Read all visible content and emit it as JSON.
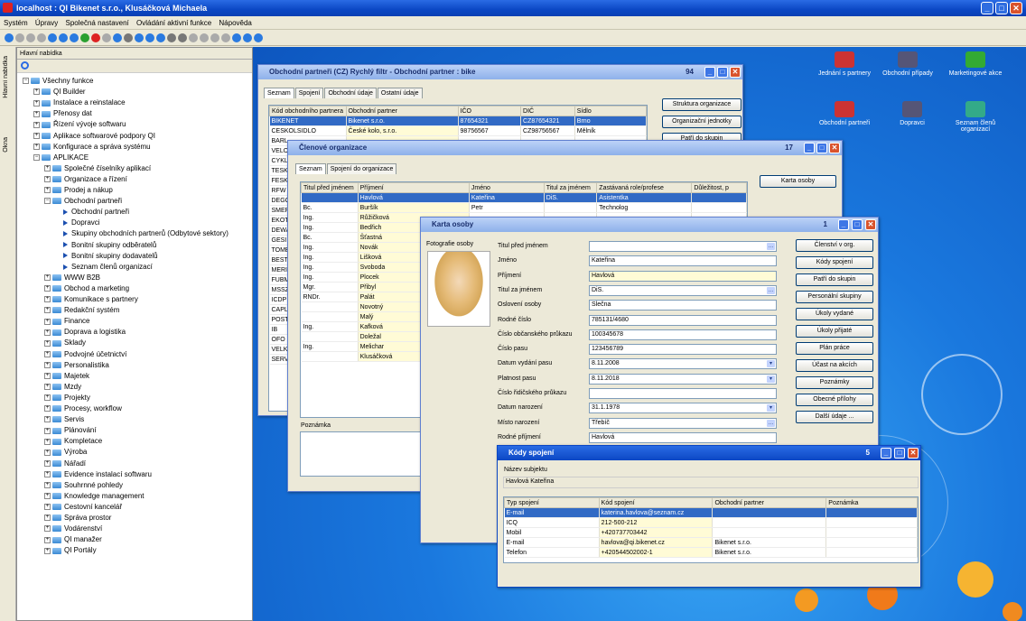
{
  "app": {
    "title": "localhost : QI  Bikenet s.r.o., Klusáčková Michaela",
    "min": "_",
    "max": "□",
    "close": "✕"
  },
  "menu": [
    "Systém",
    "Úpravy",
    "Společná nastavení",
    "Ovládání aktivní funkce",
    "Nápověda"
  ],
  "left_tabs": [
    "Hlavní nabídka",
    "Okna"
  ],
  "nav": {
    "header": "Hlavní nabídka",
    "items": [
      {
        "t": "Všechny funkce",
        "l": 0,
        "k": "f",
        "e": "−"
      },
      {
        "t": "QI Builder",
        "l": 1,
        "k": "f",
        "e": "+"
      },
      {
        "t": "Instalace a reinstalace",
        "l": 1,
        "k": "f",
        "e": "+"
      },
      {
        "t": "Přenosy dat",
        "l": 1,
        "k": "f",
        "e": "+"
      },
      {
        "t": "Řízení vývoje softwaru",
        "l": 1,
        "k": "f",
        "e": "+"
      },
      {
        "t": "Aplikace softwarové podpory QI",
        "l": 1,
        "k": "f",
        "e": "+"
      },
      {
        "t": "Konfigurace a správa systému",
        "l": 1,
        "k": "f",
        "e": "+"
      },
      {
        "t": "APLIKACE",
        "l": 1,
        "k": "f",
        "e": "−"
      },
      {
        "t": "Společné číselníky aplikací",
        "l": 2,
        "k": "f",
        "e": "+"
      },
      {
        "t": "Organizace a řízení",
        "l": 2,
        "k": "f",
        "e": "+"
      },
      {
        "t": "Prodej a nákup",
        "l": 2,
        "k": "f",
        "e": "+"
      },
      {
        "t": "Obchodní partneři",
        "l": 2,
        "k": "f",
        "e": "−"
      },
      {
        "t": "Obchodní partneři",
        "l": 3,
        "k": "a"
      },
      {
        "t": "Dopravci",
        "l": 3,
        "k": "a"
      },
      {
        "t": "Skupiny obchodních partnerů (Odbytové sektory)",
        "l": 3,
        "k": "a"
      },
      {
        "t": "Bonitní skupiny odběratelů",
        "l": 3,
        "k": "a"
      },
      {
        "t": "Bonitní skupiny dodavatelů",
        "l": 3,
        "k": "a"
      },
      {
        "t": "Seznam členů organizací",
        "l": 3,
        "k": "a"
      },
      {
        "t": "WWW B2B",
        "l": 2,
        "k": "f",
        "e": "+"
      },
      {
        "t": "Obchod a marketing",
        "l": 2,
        "k": "f",
        "e": "+"
      },
      {
        "t": "Komunikace s partnery",
        "l": 2,
        "k": "f",
        "e": "+"
      },
      {
        "t": "Redakční systém",
        "l": 2,
        "k": "f",
        "e": "+"
      },
      {
        "t": "Finance",
        "l": 2,
        "k": "f",
        "e": "+"
      },
      {
        "t": "Doprava a logistika",
        "l": 2,
        "k": "f",
        "e": "+"
      },
      {
        "t": "Sklady",
        "l": 2,
        "k": "f",
        "e": "+"
      },
      {
        "t": "Podvojné účetnictví",
        "l": 2,
        "k": "f",
        "e": "+"
      },
      {
        "t": "Personalistika",
        "l": 2,
        "k": "f",
        "e": "+"
      },
      {
        "t": "Majetek",
        "l": 2,
        "k": "f",
        "e": "+"
      },
      {
        "t": "Mzdy",
        "l": 2,
        "k": "f",
        "e": "+"
      },
      {
        "t": "Projekty",
        "l": 2,
        "k": "f",
        "e": "+"
      },
      {
        "t": "Procesy, workflow",
        "l": 2,
        "k": "f",
        "e": "+"
      },
      {
        "t": "Servis",
        "l": 2,
        "k": "f",
        "e": "+"
      },
      {
        "t": "Plánování",
        "l": 2,
        "k": "f",
        "e": "+"
      },
      {
        "t": "Kompletace",
        "l": 2,
        "k": "f",
        "e": "+"
      },
      {
        "t": "Výroba",
        "l": 2,
        "k": "f",
        "e": "+"
      },
      {
        "t": "Nářadí",
        "l": 2,
        "k": "f",
        "e": "+"
      },
      {
        "t": "Evidence instalací softwaru",
        "l": 2,
        "k": "f",
        "e": "+"
      },
      {
        "t": "Souhrnné pohledy",
        "l": 2,
        "k": "f",
        "e": "+"
      },
      {
        "t": "Knowledge management",
        "l": 2,
        "k": "f",
        "e": "+"
      },
      {
        "t": "Cestovní kancelář",
        "l": 2,
        "k": "f",
        "e": "+"
      },
      {
        "t": "Správa prostor",
        "l": 2,
        "k": "f",
        "e": "+"
      },
      {
        "t": "Vodárenství",
        "l": 2,
        "k": "f",
        "e": "+"
      },
      {
        "t": "QI manažer",
        "l": 2,
        "k": "f",
        "e": "+"
      },
      {
        "t": "QI Portály",
        "l": 2,
        "k": "f",
        "e": "+"
      }
    ]
  },
  "desktop_icons": [
    "Jednání s partnery",
    "Obchodní případy",
    "Marketingové akce",
    "Obchodní partneři",
    "Dopravci",
    "Seznam členů organizací"
  ],
  "w1": {
    "title": "Obchodní partneři (CZ)  Rychlý filtr - Obchodní partner : bike",
    "count": "94",
    "tabs": [
      "Seznam",
      "Spojení",
      "Obchodní údaje",
      "Ostatní údaje"
    ],
    "cols": [
      "Kód obchodního partnera",
      "Obchodní partner",
      "IČO",
      "DIČ",
      "Sídlo"
    ],
    "rows": [
      [
        "BIKENET",
        "Bikenet s.r.o.",
        "87654321",
        "CZ87654321",
        "Brno"
      ],
      [
        "CESKOLSIDLO",
        "České kolo, s.r.o.",
        "98756567",
        "CZ98756567",
        "Mělník"
      ],
      [
        "BARL",
        "",
        "",
        "",
        ""
      ],
      [
        "VELO",
        "",
        "",
        "",
        ""
      ],
      [
        "CYKL",
        "",
        "",
        "",
        ""
      ],
      [
        "TESK",
        "",
        "",
        "",
        ""
      ],
      [
        "FESK",
        "",
        "",
        "",
        ""
      ],
      [
        "RFW",
        "",
        "",
        "",
        ""
      ],
      [
        "DEGC",
        "",
        "",
        "",
        ""
      ],
      [
        "SMER",
        "",
        "",
        "",
        ""
      ],
      [
        "EKOT",
        "",
        "",
        "",
        ""
      ],
      [
        "DEWA",
        "",
        "",
        "",
        ""
      ],
      [
        "GESI",
        "",
        "",
        "",
        ""
      ],
      [
        "TOMB",
        "",
        "",
        "",
        ""
      ],
      [
        "BEST",
        "",
        "",
        "",
        ""
      ],
      [
        "MERI",
        "",
        "",
        "",
        ""
      ],
      [
        "FUBM",
        "",
        "",
        "",
        ""
      ],
      [
        "MSSZ",
        "",
        "",
        "",
        ""
      ],
      [
        "ICDP",
        "",
        "",
        "",
        ""
      ],
      [
        "CAPL",
        "",
        "",
        "",
        ""
      ],
      [
        "POST",
        "",
        "",
        "",
        ""
      ],
      [
        "IB",
        "",
        "",
        "",
        ""
      ],
      [
        "OFO",
        "",
        "",
        "",
        ""
      ],
      [
        "VELKO",
        "",
        "",
        "",
        ""
      ],
      [
        "SERV",
        "",
        "",
        "",
        ""
      ]
    ],
    "buttons": [
      "Struktura organizace",
      "Organizační jednotky",
      "Patří do skupin"
    ]
  },
  "w2": {
    "title": "Členové organizace",
    "count": "17",
    "tabs": [
      "Seznam",
      "Spojení do organizace"
    ],
    "cols": [
      "Titul před jménem",
      "Příjmení",
      "Jméno",
      "Titul za jménem",
      "Zastávaná role/profese",
      "Důležitost, p"
    ],
    "rows": [
      [
        "",
        "Havlová",
        "Kateřina",
        "DiS.",
        "Asistentka",
        ""
      ],
      [
        "Bc.",
        "Buršík",
        "Petr",
        "",
        "Technolog",
        ""
      ],
      [
        "Ing.",
        "Růžičková",
        "",
        "",
        "",
        ""
      ],
      [
        "Ing.",
        "Bedřich",
        "",
        "",
        "",
        ""
      ],
      [
        "Bc.",
        "Šťastná",
        "",
        "",
        "",
        ""
      ],
      [
        "Ing.",
        "Novák",
        "",
        "",
        "",
        ""
      ],
      [
        "Ing.",
        "Lišková",
        "",
        "",
        "",
        ""
      ],
      [
        "Ing.",
        "Svoboda",
        "",
        "",
        "",
        ""
      ],
      [
        "Ing.",
        "Plocek",
        "",
        "",
        "",
        ""
      ],
      [
        "Mgr.",
        "Přibyl",
        "",
        "",
        "",
        ""
      ],
      [
        "RNDr.",
        "Palát",
        "",
        "",
        "",
        ""
      ],
      [
        "",
        "Novotný",
        "",
        "",
        "",
        ""
      ],
      [
        "",
        "Malý",
        "",
        "",
        "",
        ""
      ],
      [
        "Ing.",
        "Kafková",
        "",
        "",
        "",
        ""
      ],
      [
        "",
        "Doležal",
        "",
        "",
        "",
        ""
      ],
      [
        "Ing.",
        "Melichar",
        "",
        "",
        "",
        ""
      ],
      [
        "",
        "Klusáčková",
        "",
        "",
        "",
        ""
      ]
    ],
    "note_label": "Poznámka",
    "button": "Karta osoby"
  },
  "w3": {
    "title": "Karta osoby",
    "count": "1",
    "photo_label": "Fotografie osoby",
    "fields": [
      {
        "l": "Titul před jménem",
        "v": "",
        "dd": "…"
      },
      {
        "l": "Jméno",
        "v": "Kateřina"
      },
      {
        "l": "Příjmení",
        "v": "Havlová",
        "y": true
      },
      {
        "l": "Titul za jménem",
        "v": "DiS.",
        "dd": "…"
      },
      {
        "l": "Oslovení osoby",
        "v": "Slečna"
      },
      {
        "l": "Rodné číslo",
        "v": "785131/4680"
      },
      {
        "l": "Číslo občanského průkazu",
        "v": "100345678"
      },
      {
        "l": "Číslo pasu",
        "v": "123456789"
      },
      {
        "l": "Datum vydání pasu",
        "v": "8.11.2008",
        "dd": "▾"
      },
      {
        "l": "Platnost pasu",
        "v": "8.11.2018",
        "dd": "▾"
      },
      {
        "l": "Číslo řidičského průkazu",
        "v": ""
      },
      {
        "l": "Datum narození",
        "v": "31.1.1978",
        "dd": "▾"
      },
      {
        "l": "Místo narození",
        "v": "Třebíč",
        "dd": "…"
      },
      {
        "l": "Rodné příjmení",
        "v": "Havlová"
      }
    ],
    "buttons": [
      "Členství v org.",
      "Kódy spojení",
      "Patří do skupin",
      "Personální skupiny",
      "Úkoly vydané",
      "Úkoly přijaté",
      "Plán práce",
      "Účast na akcích",
      "Poznámky",
      "Obecné přílohy",
      "Další údaje ..."
    ]
  },
  "w4": {
    "title": "Kódy spojení",
    "count": "5",
    "subject_label": "Název subjektu",
    "subject": "Havlová Kateřina",
    "cols": [
      "Typ spojení",
      "Kód spojení",
      "Obchodní partner",
      "Poznámka"
    ],
    "rows": [
      [
        "E-mail",
        "katerina.havlova@seznam.cz",
        "",
        ""
      ],
      [
        "ICQ",
        "212-500-212",
        "",
        ""
      ],
      [
        "Mobil",
        "+420737703442",
        "",
        ""
      ],
      [
        "E-mail",
        "havlova@qi.bikenet.cz",
        "Bikenet s.r.o.",
        ""
      ],
      [
        "Telefon",
        "+420544502002-1",
        "Bikenet s.r.o.",
        ""
      ]
    ]
  }
}
